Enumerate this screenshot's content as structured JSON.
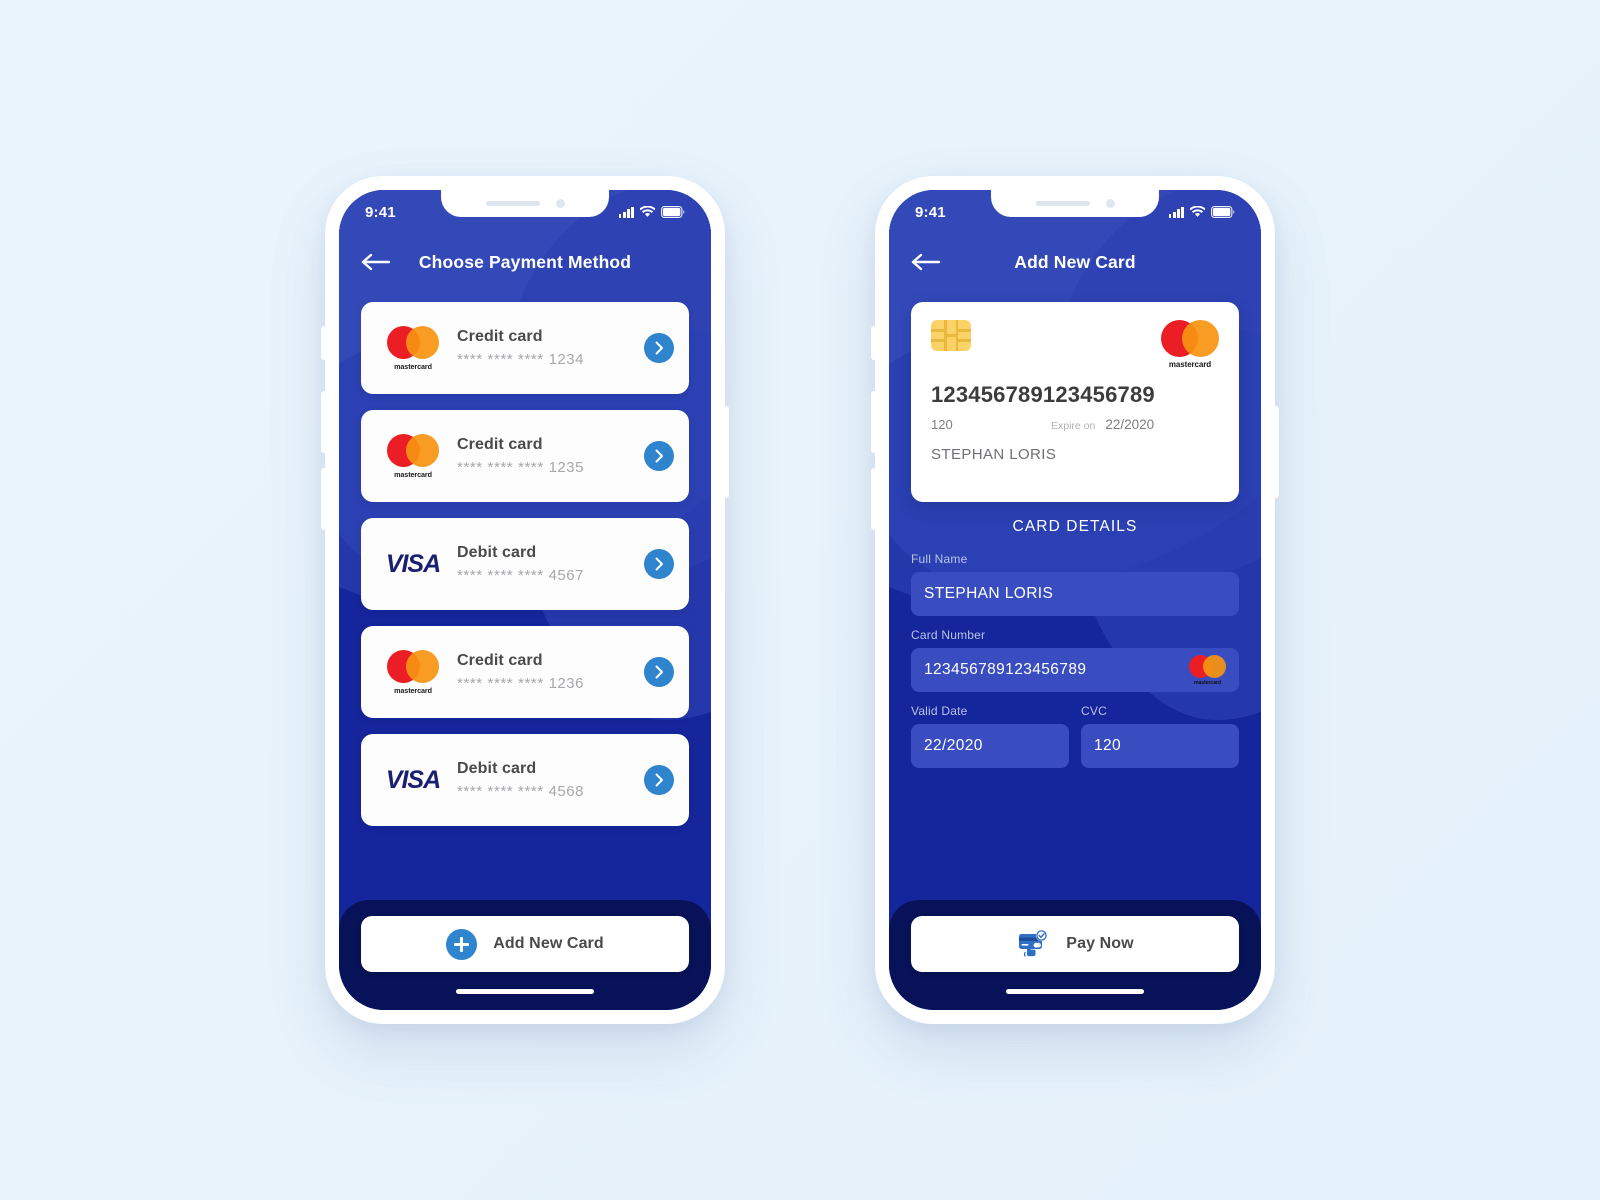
{
  "app": {
    "accent_blue": "#2f85cd",
    "screen_bg": "#15259b",
    "bottom_bar_bg": "#071258",
    "field_bg": "#3a4dc0",
    "page_bg": "#eaf4fc"
  },
  "phone1": {
    "status_bar": {
      "time": "9:41",
      "icons": [
        "signal-icon",
        "wifi-icon",
        "battery-icon"
      ]
    },
    "header": {
      "title": "Choose Payment Method",
      "back_icon": "arrow-left-icon"
    },
    "payment_methods": [
      {
        "brand": "mastercard",
        "brand_label": "mastercard",
        "title": "Credit card",
        "masked": "**** **** ****",
        "last4": "1234",
        "chevron_icon": "chevron-right-icon"
      },
      {
        "brand": "mastercard",
        "brand_label": "mastercard",
        "title": "Credit card",
        "masked": "**** **** ****",
        "last4": "1235",
        "chevron_icon": "chevron-right-icon"
      },
      {
        "brand": "visa",
        "brand_label": "VISA",
        "title": "Debit card",
        "masked": "**** **** ****",
        "last4": "4567",
        "chevron_icon": "chevron-right-icon"
      },
      {
        "brand": "mastercard",
        "brand_label": "mastercard",
        "title": "Credit card",
        "masked": "**** **** ****",
        "last4": "1236",
        "chevron_icon": "chevron-right-icon"
      },
      {
        "brand": "visa",
        "brand_label": "VISA",
        "title": "Debit card",
        "masked": "**** **** ****",
        "last4": "4568",
        "chevron_icon": "chevron-right-icon"
      }
    ],
    "cta": {
      "label": "Add New Card",
      "icon": "plus-circle-icon"
    }
  },
  "phone2": {
    "status_bar": {
      "time": "9:41",
      "icons": [
        "signal-icon",
        "wifi-icon",
        "battery-icon"
      ]
    },
    "header": {
      "title": "Add New Card",
      "back_icon": "arrow-left-icon"
    },
    "card_preview": {
      "chip_icon": "emv-chip-icon",
      "brand": "mastercard",
      "brand_label": "mastercard",
      "number": "123456789123456789",
      "cvc": "120",
      "expire_label": "Expire on",
      "expire_value": "22/2020",
      "holder_name": "STEPHAN LORIS"
    },
    "section_title": "CARD DETAILS",
    "fields": {
      "full_name": {
        "label": "Full Name",
        "value": "STEPHAN LORIS"
      },
      "card_number": {
        "label": "Card Number",
        "value": "123456789123456789",
        "brand_icon": "mastercard-icon"
      },
      "valid_date": {
        "label": "Valid Date",
        "value": "22/2020"
      },
      "cvc": {
        "label": "CVC",
        "value": "120"
      }
    },
    "cta": {
      "label": "Pay Now",
      "icon": "card-tap-pay-icon"
    }
  }
}
